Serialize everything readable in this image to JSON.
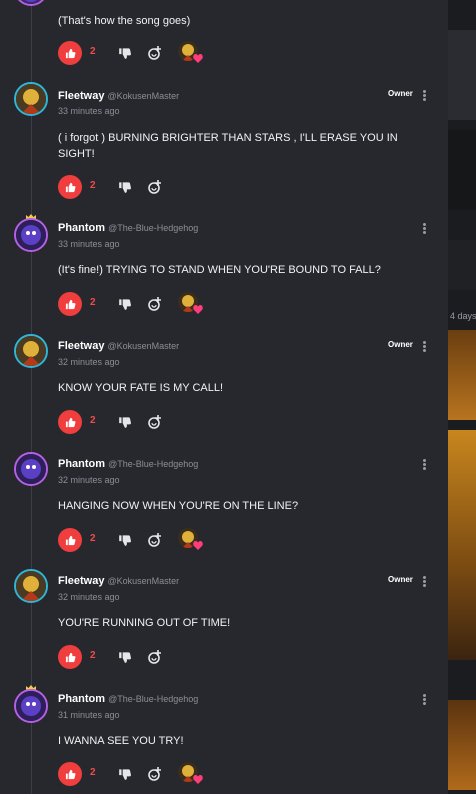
{
  "comments": [
    {
      "author": "",
      "handle": "",
      "time": "",
      "text": "(That's how the song goes)",
      "likes": "2",
      "owner": "",
      "creator_heart": true
    },
    {
      "author": "Fleetway",
      "handle": "@KokusenMaster",
      "time": "33 minutes ago",
      "text": "( i forgot ) BURNING BRIGHTER THAN STARS , I'LL ERASE YOU IN SIGHT!",
      "likes": "2",
      "owner": "Owner",
      "creator_heart": false
    },
    {
      "author": "Phantom",
      "handle": "@The-Blue-Hedgehog",
      "time": "33 minutes ago",
      "text": "(It's fine!) TRYING TO STAND WHEN YOU'RE BOUND TO FALL?",
      "likes": "2",
      "owner": "",
      "creator_heart": true
    },
    {
      "author": "Fleetway",
      "handle": "@KokusenMaster",
      "time": "32 minutes ago",
      "text": "KNOW YOUR FATE IS MY CALL!",
      "likes": "2",
      "owner": "Owner",
      "creator_heart": false
    },
    {
      "author": "Phantom",
      "handle": "@The-Blue-Hedgehog",
      "time": "32 minutes ago",
      "text": "HANGING NOW WHEN YOU'RE ON THE LINE?",
      "likes": "2",
      "owner": "",
      "creator_heart": true
    },
    {
      "author": "Fleetway",
      "handle": "@KokusenMaster",
      "time": "32 minutes ago",
      "text": "YOU'RE RUNNING OUT OF TIME!",
      "likes": "2",
      "owner": "Owner",
      "creator_heart": false
    },
    {
      "author": "Phantom",
      "handle": "@The-Blue-Hedgehog",
      "time": "31 minutes ago",
      "text": "I WANNA SEE YOU TRY!",
      "likes": "2",
      "owner": "",
      "creator_heart": true
    }
  ],
  "side": {
    "label": "4 days"
  },
  "colors": {
    "like": "#f03d3d",
    "background": "#27282e",
    "fleetway_ring": "#2fb6d8",
    "phantom_ring": "#b660e6",
    "heart": "#ff3d7a"
  },
  "icons": [
    "thumbs-up-icon",
    "thumbs-down-icon",
    "reply-icon",
    "more-vert-icon",
    "heart-icon",
    "crown-icon"
  ]
}
